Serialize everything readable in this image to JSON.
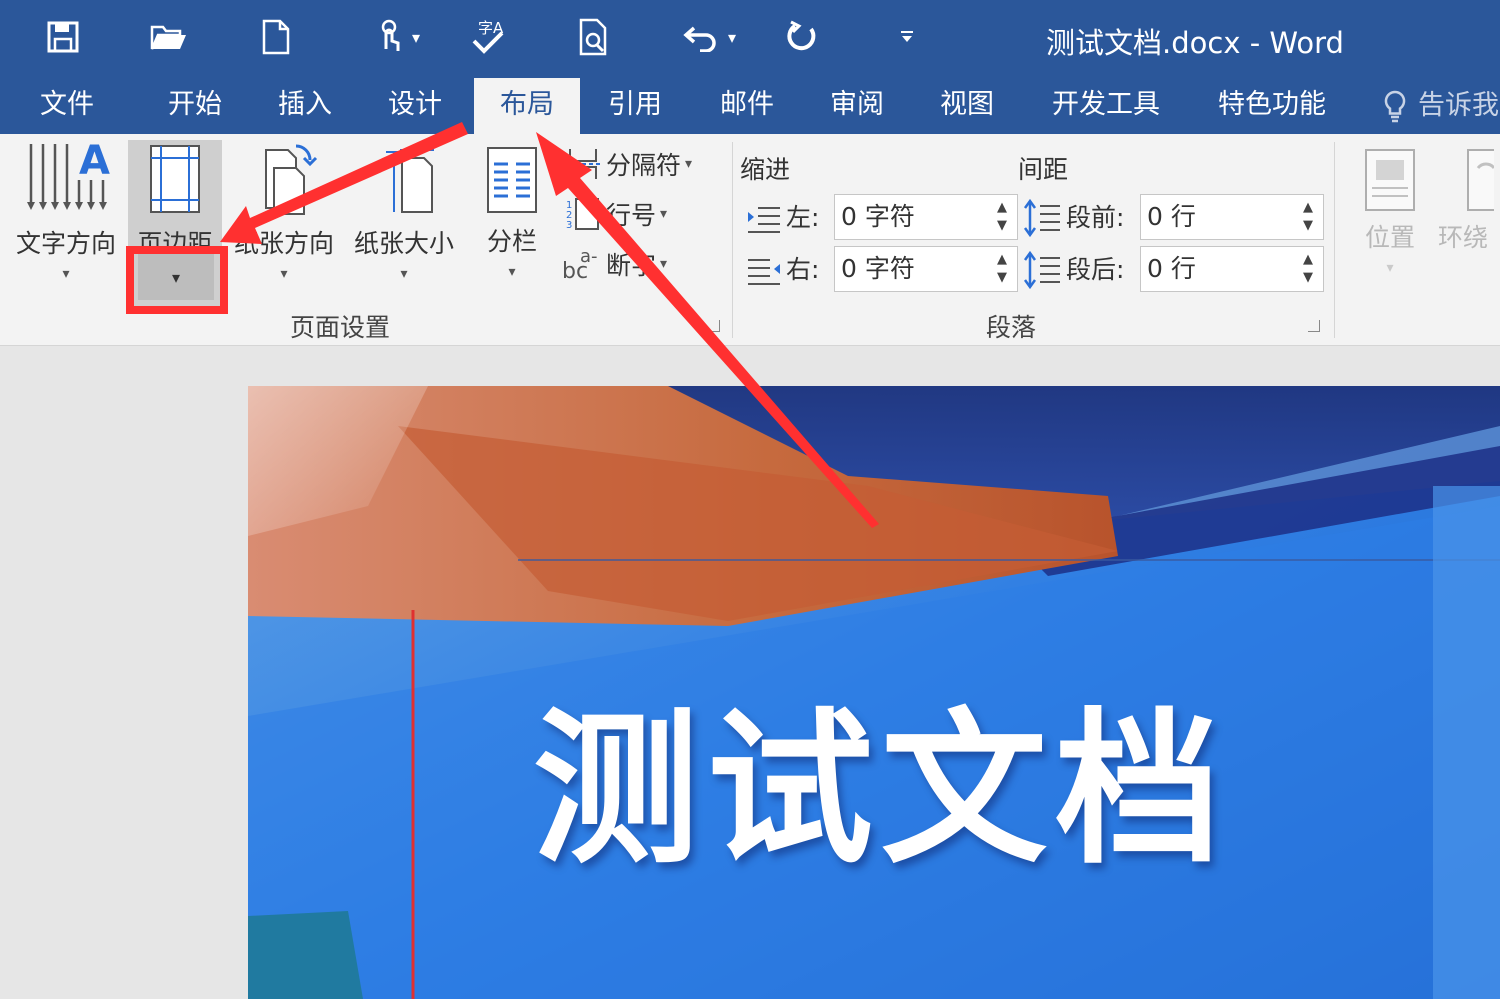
{
  "window": {
    "title": "测试文档.docx - Word",
    "qat_caret": "▾"
  },
  "tabs": [
    "文件",
    "开始",
    "插入",
    "设计",
    "布局",
    "引用",
    "邮件",
    "审阅",
    "视图",
    "开发工具",
    "特色功能"
  ],
  "active_tab": "布局",
  "tell_me": "告诉我",
  "page_setup": {
    "text_direction": "文字方向",
    "margins": "页边距",
    "orientation": "纸张方向",
    "size": "纸张大小",
    "columns": "分栏",
    "breaks": "分隔符",
    "line_numbers": "行号",
    "hyphenation": "断字",
    "group_label": "页面设置",
    "dropdown_caret": "▾"
  },
  "paragraph": {
    "indent_heading": "缩进",
    "spacing_heading": "间距",
    "left_label": "左:",
    "left_value": "0 字符",
    "right_label": "右:",
    "right_value": "0 字符",
    "before_label": "段前:",
    "before_value": "0 行",
    "after_label": "段后:",
    "after_value": "0 行",
    "group_label": "段落",
    "spin_up": "▲",
    "spin_down": "▼"
  },
  "arrange": {
    "position": "位置",
    "wrap": "环绕"
  },
  "document": {
    "heading": "测试文档"
  },
  "colors": {
    "title_bar": "#2b579a",
    "ribbon": "#f3f3f3",
    "annotation": "#ff3030",
    "page_blue": "#2f7ee3"
  }
}
